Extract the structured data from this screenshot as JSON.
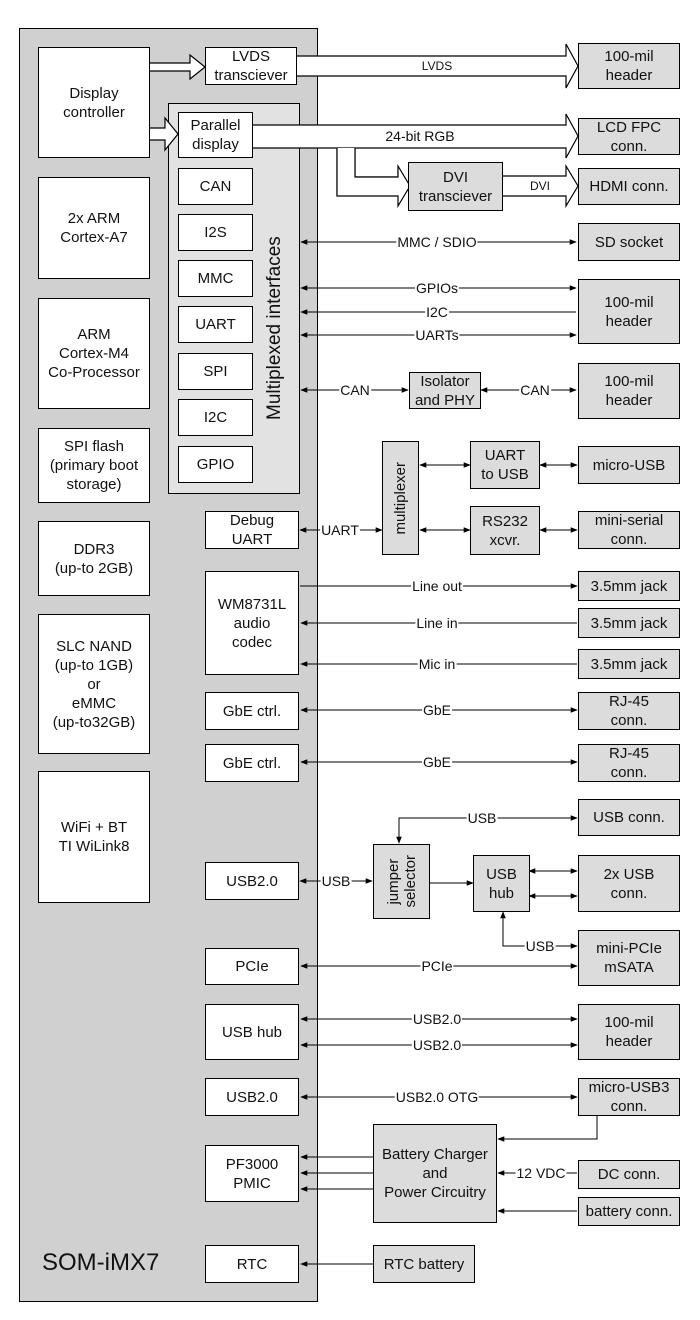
{
  "module": {
    "title": "SOM-iMX7",
    "mux_group_label": "Multiplexed interfaces"
  },
  "internal_blocks": {
    "display_controller": "Display\ncontroller",
    "arm_a7": "2x ARM\nCortex-A7",
    "arm_m4": "ARM\nCortex-M4\nCo-Processor",
    "spi_flash": "SPI flash\n(primary boot\nstorage)",
    "ddr3": "DDR3\n(up-to 2GB)",
    "nand": "SLC NAND\n(up-to 1GB)\nor\neMMC\n(up-to32GB)",
    "wifi": "WiFi + BT\nTI WiLink8",
    "lvds_xcvr": "LVDS\ntransciever",
    "parallel_display": "Parallel\ndisplay",
    "can": "CAN",
    "i2s": "I2S",
    "mmc": "MMC",
    "uart": "UART",
    "spi": "SPI",
    "i2c": "I2C",
    "gpio": "GPIO",
    "debug_uart": "Debug\nUART",
    "audio_codec": "WM8731L\naudio\ncodec",
    "gbe1": "GbE ctrl.",
    "gbe2": "GbE ctrl.",
    "usb20_a": "USB2.0",
    "pcie": "PCIe",
    "usb_hub_int": "USB hub",
    "usb20_b": "USB2.0",
    "pmic": "PF3000\nPMIC",
    "rtc": "RTC"
  },
  "carrier_blocks": {
    "dvi_xcvr": "DVI\ntransciever",
    "isolator": "Isolator\nand PHY",
    "multiplexer": "multiplexer",
    "uart_to_usb": "UART\nto USB",
    "rs232": "RS232\nxcvr.",
    "jumper": "jumper\nselector",
    "usb_hub_ext": "USB\nhub",
    "charger": "Battery Charger\nand\nPower Circuitry",
    "rtc_battery": "RTC battery"
  },
  "connectors": {
    "hdr_lvds": "100-mil\nheader",
    "lcd_fpc": "LCD FPC\nconn.",
    "hdmi": "HDMI conn.",
    "sd": "SD socket",
    "hdr_gpio": "100-mil\nheader",
    "hdr_can": "100-mil\nheader",
    "micro_usb": "micro-USB",
    "mini_serial": "mini-serial\nconn.",
    "jack1": "3.5mm jack",
    "jack2": "3.5mm jack",
    "jack3": "3.5mm jack",
    "rj45_1": "RJ-45\nconn.",
    "rj45_2": "RJ-45\nconn.",
    "usb_conn": "USB conn.",
    "usb2x": "2x USB\nconn.",
    "minipcie": "mini-PCIe\nmSATA",
    "hdr_usb": "100-mil\nheader",
    "micro_usb3": "micro-USB3\nconn.",
    "dc": "DC conn.",
    "battery": "battery conn."
  },
  "signals": {
    "lvds": "LVDS",
    "rgb": "24-bit RGB",
    "dvi": "DVI",
    "mmc_sdio": "MMC / SDIO",
    "gpios": "GPIOs",
    "i2c": "I2C",
    "uarts": "UARTs",
    "can1": "CAN",
    "can2": "CAN",
    "uart": "UART",
    "line_out": "Line out",
    "line_in": "Line in",
    "mic_in": "Mic in",
    "gbe1": "GbE",
    "gbe2": "GbE",
    "usb_top": "USB",
    "usb_left": "USB",
    "usb_minipcie": "USB",
    "pcie": "PCIe",
    "usb20_1": "USB2.0",
    "usb20_2": "USB2.0",
    "otg": "USB2.0 OTG",
    "vdc": "12 VDC"
  }
}
